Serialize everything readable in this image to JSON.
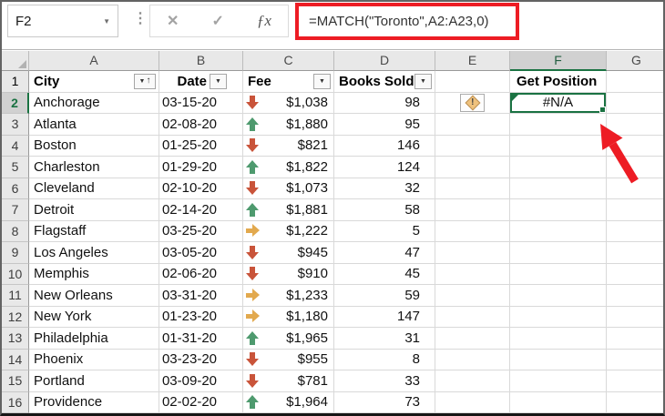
{
  "formula_bar": {
    "name_box_value": "F2",
    "formula": "=MATCH(\"Toronto\",A2:A23,0)",
    "cancel_icon": "✕",
    "enter_icon": "✓",
    "fx_icon": "ƒx",
    "dropdown_icon": "▼",
    "separator_dots": "⋮"
  },
  "grid": {
    "column_letters": [
      "A",
      "B",
      "C",
      "D",
      "E",
      "F",
      "G"
    ],
    "selected_column_letter": "F",
    "header_row_number": "1",
    "selected_row_number": "2",
    "filter_caret": "▼",
    "sort_ascending_mark": "↑",
    "warning_mark": "!",
    "header_cells": {
      "city": "City",
      "date": "Date",
      "fee": "Fee",
      "books_sold": "Books Sold",
      "get_position": "Get Position"
    },
    "rows": [
      {
        "n": "2",
        "city": "Anchorage",
        "date": "03-15-20",
        "trend": "down",
        "fee": "$1,038",
        "books": "98",
        "has_warning": true,
        "get_position": "#N/A",
        "selected": true
      },
      {
        "n": "3",
        "city": "Atlanta",
        "date": "02-08-20",
        "trend": "up",
        "fee": "$1,880",
        "books": "95"
      },
      {
        "n": "4",
        "city": "Boston",
        "date": "01-25-20",
        "trend": "down",
        "fee": "$821",
        "books": "146"
      },
      {
        "n": "5",
        "city": "Charleston",
        "date": "01-29-20",
        "trend": "up",
        "fee": "$1,822",
        "books": "124"
      },
      {
        "n": "6",
        "city": "Cleveland",
        "date": "02-10-20",
        "trend": "down",
        "fee": "$1,073",
        "books": "32"
      },
      {
        "n": "7",
        "city": "Detroit",
        "date": "02-14-20",
        "trend": "up",
        "fee": "$1,881",
        "books": "58"
      },
      {
        "n": "8",
        "city": "Flagstaff",
        "date": "03-25-20",
        "trend": "right",
        "fee": "$1,222",
        "books": "5"
      },
      {
        "n": "9",
        "city": "Los Angeles",
        "date": "03-05-20",
        "trend": "down",
        "fee": "$945",
        "books": "47"
      },
      {
        "n": "10",
        "city": "Memphis",
        "date": "02-06-20",
        "trend": "down",
        "fee": "$910",
        "books": "45"
      },
      {
        "n": "11",
        "city": "New Orleans",
        "date": "03-31-20",
        "trend": "right",
        "fee": "$1,233",
        "books": "59"
      },
      {
        "n": "12",
        "city": "New York",
        "date": "01-23-20",
        "trend": "right",
        "fee": "$1,180",
        "books": "147"
      },
      {
        "n": "13",
        "city": "Philadelphia",
        "date": "01-31-20",
        "trend": "up",
        "fee": "$1,965",
        "books": "31"
      },
      {
        "n": "14",
        "city": "Phoenix",
        "date": "03-23-20",
        "trend": "down",
        "fee": "$955",
        "books": "8"
      },
      {
        "n": "15",
        "city": "Portland",
        "date": "03-09-20",
        "trend": "down",
        "fee": "$781",
        "books": "33"
      },
      {
        "n": "16",
        "city": "Providence",
        "date": "02-02-20",
        "trend": "up",
        "fee": "$1,964",
        "books": "73"
      }
    ]
  },
  "colors": {
    "accent_green": "#1a7242",
    "annotation_red": "#ed1c24",
    "arrow_up": "#4e9a6e",
    "arrow_down": "#c9543a",
    "arrow_right": "#e2a94e"
  }
}
